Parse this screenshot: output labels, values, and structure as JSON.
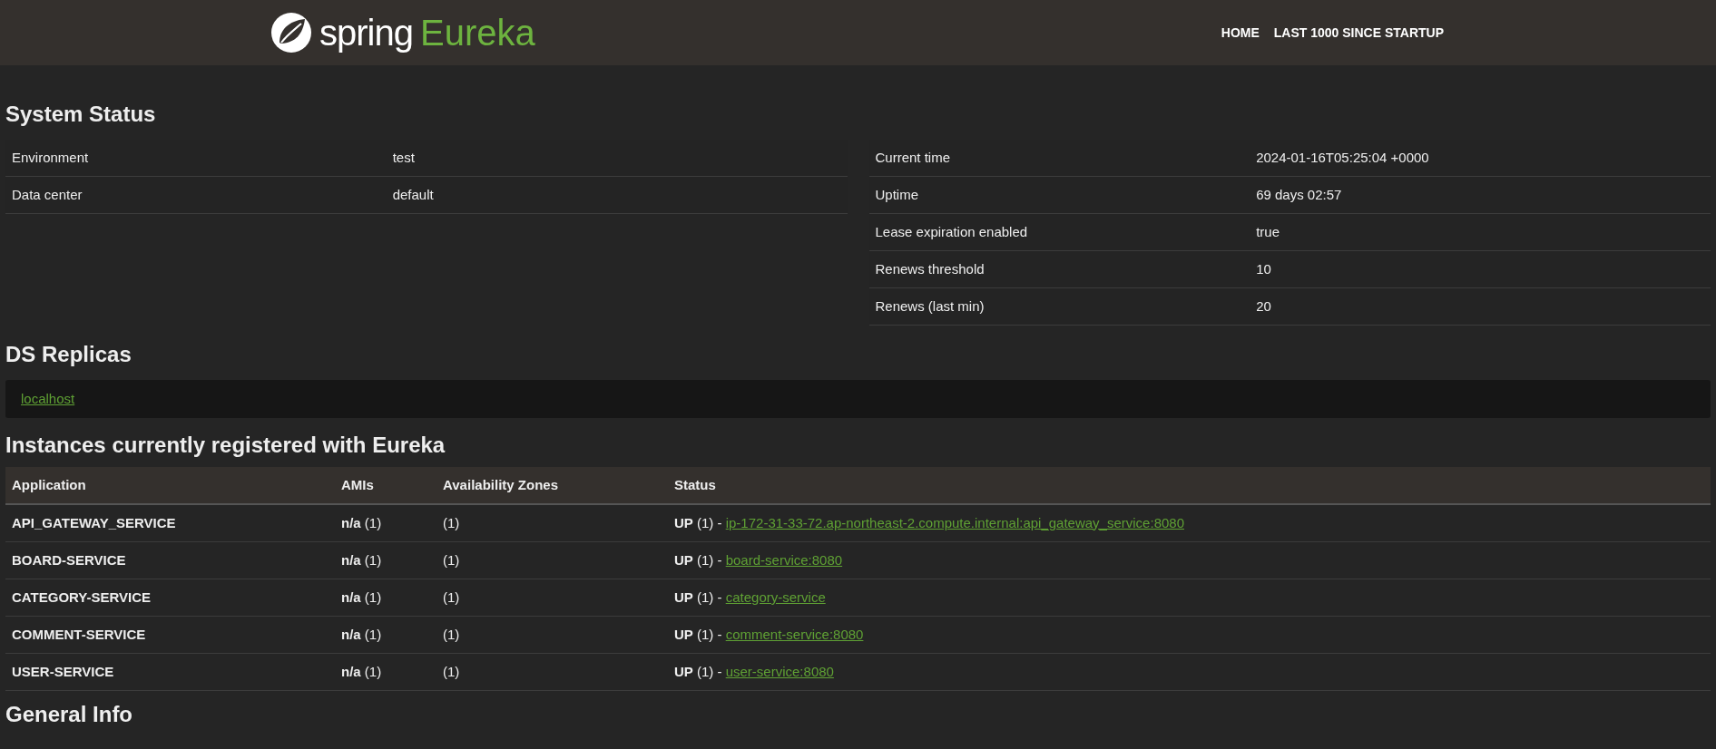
{
  "header": {
    "logo_text": "spring",
    "logo_product": "Eureka",
    "nav": [
      "HOME",
      "LAST 1000 SINCE STARTUP"
    ]
  },
  "system_status": {
    "title": "System Status",
    "left": [
      {
        "label": "Environment",
        "value": "test"
      },
      {
        "label": "Data center",
        "value": "default"
      }
    ],
    "right": [
      {
        "label": "Current time",
        "value": "2024-01-16T05:25:04 +0000"
      },
      {
        "label": "Uptime",
        "value": "69 days 02:57"
      },
      {
        "label": "Lease expiration enabled",
        "value": "true"
      },
      {
        "label": "Renews threshold",
        "value": "10"
      },
      {
        "label": "Renews (last min)",
        "value": "20"
      }
    ]
  },
  "ds_replicas": {
    "title": "DS Replicas",
    "links": [
      "localhost"
    ]
  },
  "instances": {
    "title": "Instances currently registered with Eureka",
    "columns": [
      "Application",
      "AMIs",
      "Availability Zones",
      "Status"
    ],
    "rows": [
      {
        "application": "API_GATEWAY_SERVICE",
        "amis": "**n/a** (1)",
        "zones": "(1)",
        "status": "**UP** (1) - ",
        "link": "ip-172-31-33-72.ap-northeast-2.compute.internal:api_gateway_service:8080"
      },
      {
        "application": "BOARD-SERVICE",
        "amis": "**n/a** (1)",
        "zones": "(1)",
        "status": "**UP** (1) - ",
        "link": "board-service:8080"
      },
      {
        "application": "CATEGORY-SERVICE",
        "amis": "**n/a** (1)",
        "zones": "(1)",
        "status": "**UP** (1) - ",
        "link": "category-service"
      },
      {
        "application": "COMMENT-SERVICE",
        "amis": "**n/a** (1)",
        "zones": "(1)",
        "status": "**UP** (1) - ",
        "link": "comment-service:8080"
      },
      {
        "application": "USER-SERVICE",
        "amis": "**n/a** (1)",
        "zones": "(1)",
        "status": "**UP** (1) - ",
        "link": "user-service:8080"
      }
    ]
  },
  "general_info": {
    "title": "General Info"
  }
}
